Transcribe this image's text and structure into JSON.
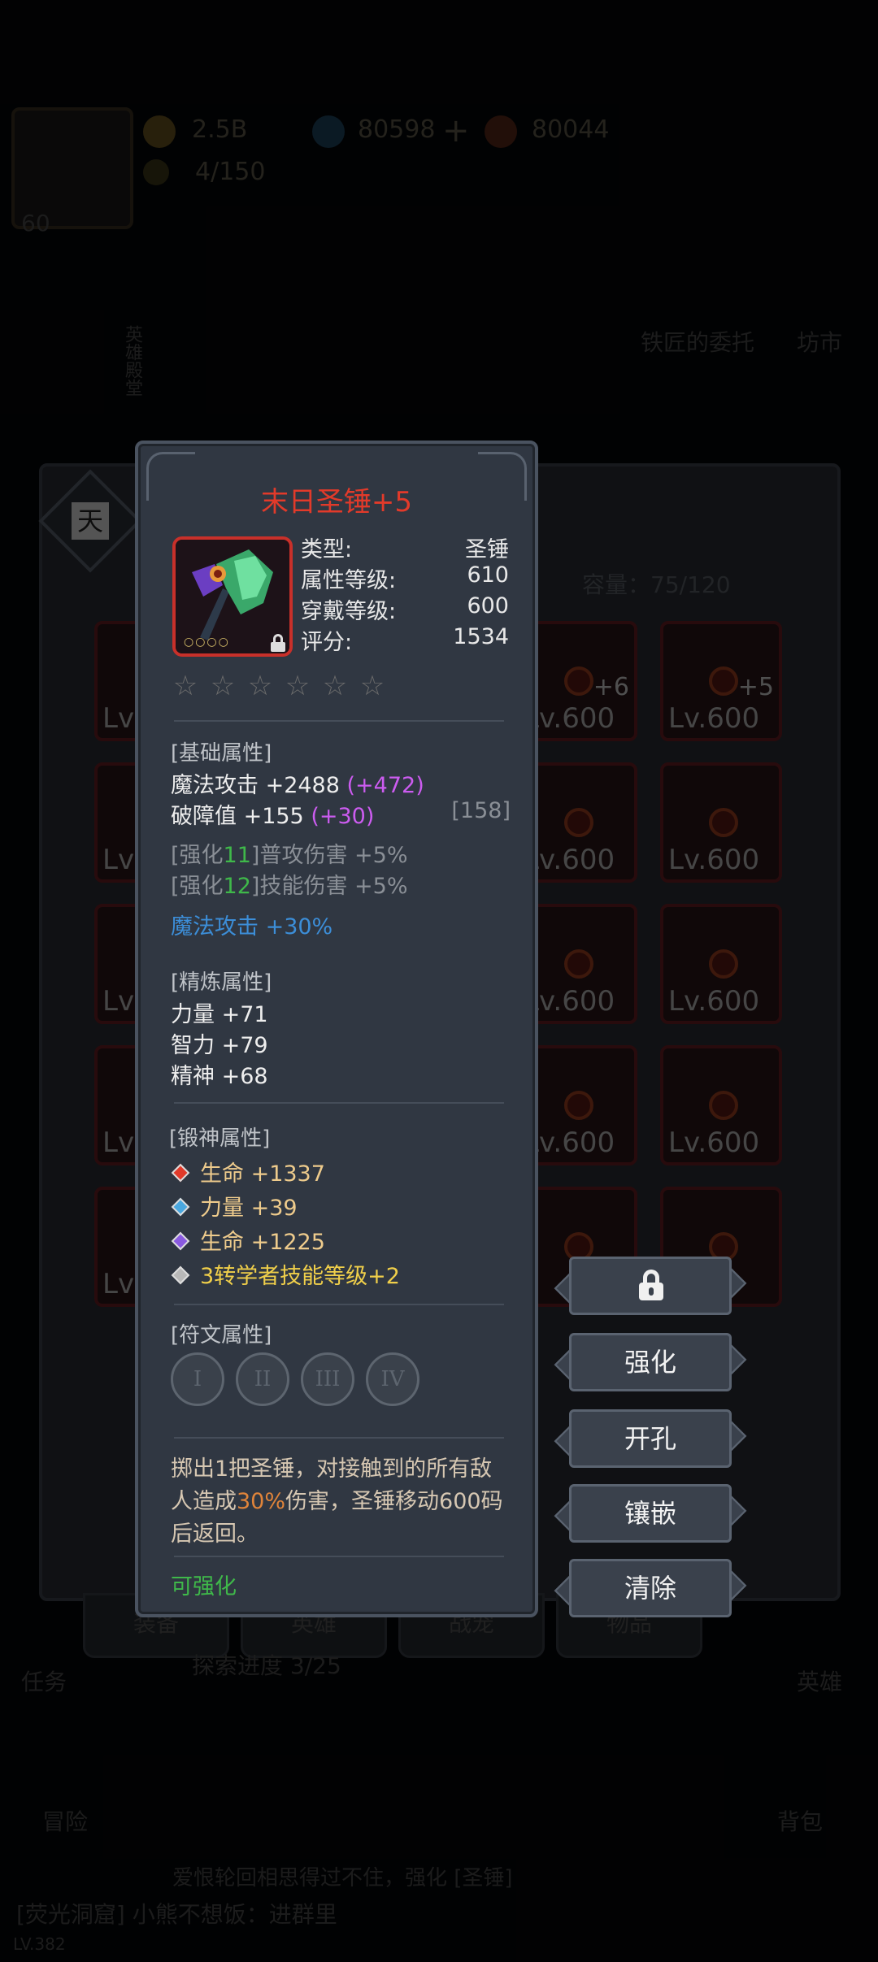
{
  "background": {
    "gold": "2.5B",
    "diamonds": "80598",
    "energy": "80044",
    "stamina": "4/150",
    "level": "60",
    "side_label": "英雄殿堂",
    "blacksmith_task": "铁匠的委托",
    "market": "坊市",
    "sky_badge": "天",
    "capacity": "容量：75/120",
    "slot_labels": [
      "Lv.600",
      "+6",
      "+5"
    ],
    "tabs": [
      "装备",
      "英雄",
      "战宠",
      "物品"
    ],
    "quest": "任务",
    "explore": "探索进度 3/25",
    "adventure": "冒险",
    "heroes": "英雄",
    "backpack": "背包",
    "chat_line_1": "爱恨轮回相思得过不住，强化 [圣锤]",
    "chat_line_2": "[荧光洞窟] 小熊不想饭：进群里",
    "player_level": "LV.382"
  },
  "item": {
    "name": "末日圣锤+5",
    "type_label": "类型:",
    "type_value": "圣锤",
    "attr_level_label": "属性等级:",
    "attr_level_value": "610",
    "wear_level_label": "穿戴等级:",
    "wear_level_value": "600",
    "score_label": "评分:",
    "score_value": "1534",
    "stars": 6
  },
  "base_attrs": {
    "header": "[基础属性]",
    "magic_attack": "魔法攻击 +2488",
    "magic_attack_bonus": "(+472)",
    "shield_break": "破障值 +155",
    "shield_break_bonus": "(+30)",
    "shield_break_extra": "[158]",
    "enh11_prefix": "[强化",
    "enh11_num": "11",
    "enh11_suffix": "]普攻伤害 +5%",
    "enh12_prefix": "[强化",
    "enh12_num": "12",
    "enh12_suffix": "]技能伤害 +5%",
    "special": "魔法攻击 +30%"
  },
  "refine_attrs": {
    "header": "[精炼属性]",
    "strength": "力量 +71",
    "intelligence": "智力 +79",
    "spirit": "精神 +68"
  },
  "forge_attrs": {
    "header": "[锻神属性]",
    "items": [
      {
        "text": "生命 +1337",
        "color": "#e23a2a"
      },
      {
        "text": "力量 +39",
        "color": "#4aa8e0"
      },
      {
        "text": "生命 +1225",
        "color": "#8a5ae0"
      },
      {
        "text": "3转学者技能等级+2",
        "color": "#d8d8d8"
      }
    ]
  },
  "rune_attrs": {
    "header": "[符文属性]",
    "slots": [
      "I",
      "II",
      "III",
      "IV"
    ]
  },
  "description": {
    "part1": "掷出1把圣锤，对接触到的所有敌人造成",
    "highlight": "30%",
    "part2": "伤害，圣锤移动600码后返回。"
  },
  "status": "可强化",
  "actions": {
    "enhance": "强化",
    "socket": "开孔",
    "inlay": "镶嵌",
    "clear": "清除"
  }
}
